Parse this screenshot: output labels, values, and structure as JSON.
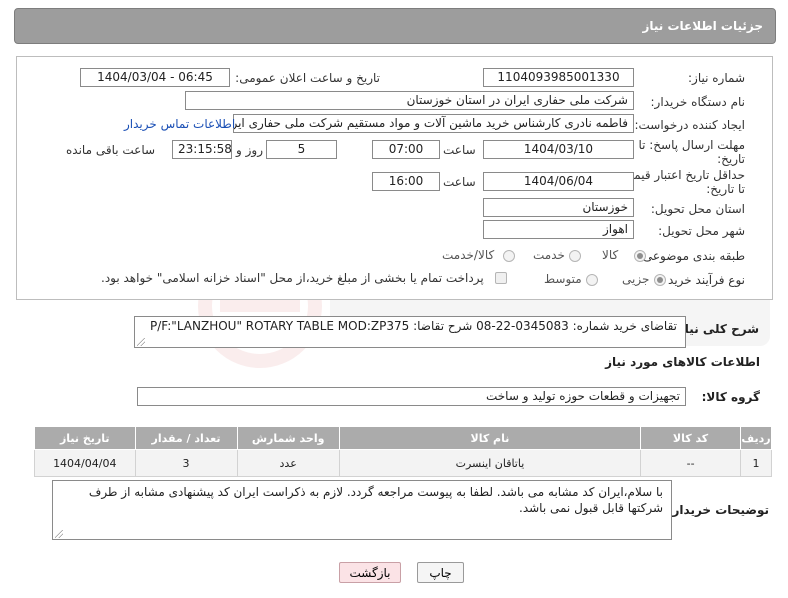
{
  "header": {
    "title": "جزئیات اطلاعات نیاز"
  },
  "form": {
    "need_number": {
      "label": "شماره نیاز:",
      "value": "1104093985001330"
    },
    "announce": {
      "label": "تاریخ و ساعت اعلان عمومی:",
      "value": "1404/03/04 - 06:45"
    },
    "buyer_org": {
      "label": "نام دستگاه خریدار:",
      "value": "شرکت ملی حفاری ایران در استان خوزستان"
    },
    "creator": {
      "label": "ایجاد کننده درخواست:",
      "value": "فاطمه نادری کارشناس خرید ماشین آلات و مواد مستقیم شرکت ملی حفاری ایر",
      "contact_link": "اطلاعات تماس خریدار"
    },
    "reply_deadline": {
      "label_line1": "مهلت ارسال پاسخ: تا",
      "label_line2": "تاریخ:",
      "date": "1404/03/10",
      "time_label": "ساعت",
      "time": "07:00",
      "days": "5",
      "days_label": "روز و",
      "remaining": "23:15:58",
      "remaining_label": "ساعت باقی مانده"
    },
    "price_validity": {
      "label_line1": "حداقل تاریخ اعتبار قیمت:",
      "label_line2": "تا تاریخ:",
      "date": "1404/06/04",
      "time_label": "ساعت",
      "time": "16:00"
    },
    "province": {
      "label": "استان محل تحویل:",
      "value": "خوزستان"
    },
    "city": {
      "label": "شهر محل تحویل:",
      "value": "اهواز"
    },
    "category": {
      "label": "طبقه بندی موضوعی:",
      "options": [
        "کالا",
        "خدمت",
        "کالا/خدمت"
      ],
      "selected": "کالا"
    },
    "process": {
      "label": "نوع فرآیند خرید :",
      "options": [
        "جزیی",
        "متوسط"
      ],
      "selected": "جزیی",
      "payment_note": "پرداخت تمام یا بخشی از مبلغ خرید،از محل \"اسناد خزانه اسلامی\" خواهد بود."
    }
  },
  "description": {
    "label": "شرح کلی نیاز:",
    "text": "تقاضای خرید شماره:  0345083-22-08  شرح تقاضا: P/F:\"LANZHOU\" ROTARY TABLE MOD:ZP375"
  },
  "goods_section": {
    "title": "اطلاعات کالاهای مورد نیاز"
  },
  "goods_group": {
    "label": "گروه کالا:",
    "value": "تجهیزات و قطعات حوزه تولید و ساخت"
  },
  "table": {
    "headers": [
      "ردیف",
      "کد کالا",
      "نام کالا",
      "واحد شمارش",
      "تعداد / مقدار",
      "تاریخ نیاز"
    ],
    "rows": [
      [
        "1",
        "--",
        "یاتاقان اینسرت",
        "عدد",
        "3",
        "1404/04/04"
      ]
    ]
  },
  "notes": {
    "label": "توضیحات خریدار:",
    "text": "با سلام،ایران کد مشابه می باشد. لطفا به پیوست مراجعه گردد. لازم به ذکراست ایران کد پیشنهادی مشابه از طرف شرکتها قابل قبول نمی باشد."
  },
  "buttons": {
    "print": "چاپ",
    "back": "بازگشت"
  },
  "colors": {
    "header_bg": "#9d9d9d",
    "table_header_bg": "#ababab",
    "link": "#1a4fb5",
    "back_button_bg": "#fbe3e6"
  }
}
